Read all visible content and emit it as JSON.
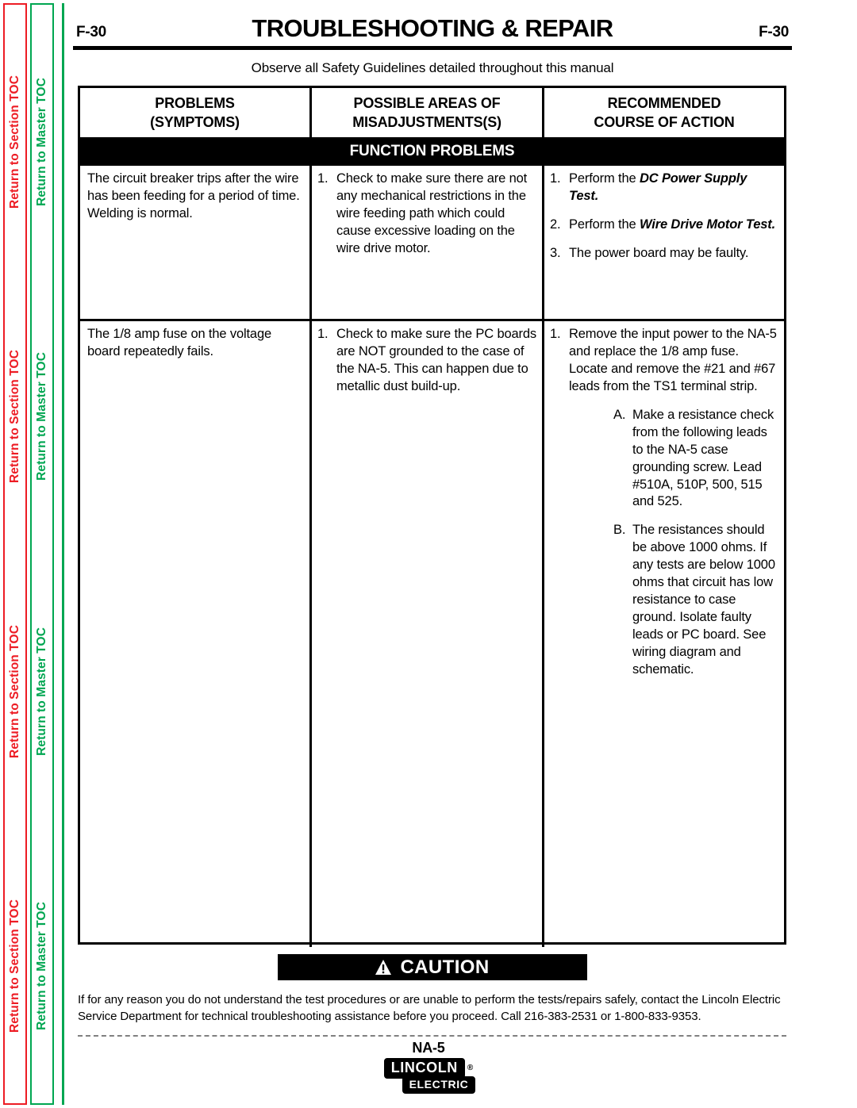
{
  "nav": {
    "section_toc_label": "Return to Section TOC",
    "master_toc_label": "Return to Master TOC",
    "section_color": "#ED1C24",
    "master_color": "#00A651",
    "repeat_count": 4
  },
  "header": {
    "folio_left": "F-30",
    "title": "TROUBLESHOOTING & REPAIR",
    "folio_right": "F-30",
    "safety_note": "Observe all Safety Guidelines detailed throughout this manual"
  },
  "table": {
    "headers": [
      {
        "line1": "PROBLEMS",
        "line2": "(SYMPTOMS)"
      },
      {
        "line1": "POSSIBLE AREAS OF",
        "line2": "MISADJUSTMENTS(S)"
      },
      {
        "line1": "RECOMMENDED",
        "line2": "COURSE OF ACTION"
      }
    ],
    "section_band": "FUNCTION PROBLEMS",
    "rows": [
      {
        "symptom": "The circuit breaker trips after the wire has been feeding for a period of time.  Welding is normal.",
        "areas": [
          {
            "marker": "1.",
            "text": "Check to make sure there are not any mechanical restrictions in the wire feeding path which could cause excessive loading on the wire drive motor."
          }
        ],
        "actions": [
          {
            "marker": "1.",
            "lead": "Perform the ",
            "emphasis": "DC Power Supply Test.",
            "tail": ""
          },
          {
            "marker": "2.",
            "lead": "Perform the ",
            "emphasis": "Wire Drive Motor Test.",
            "tail": ""
          },
          {
            "marker": "3.",
            "lead": "The power board may be faulty.",
            "emphasis": "",
            "tail": ""
          }
        ]
      },
      {
        "symptom": "The 1/8 amp fuse on the voltage board repeatedly fails.",
        "areas": [
          {
            "marker": "1.",
            "text": "Check to make sure the PC boards are NOT grounded to the case of the NA-5.  This can happen due to metallic dust build-up."
          }
        ],
        "actions": [
          {
            "marker": "1.",
            "lead": "Remove the input power to the NA-5 and replace the 1/8 amp fuse.  Locate and remove the #21 and #67 leads from the TS1 terminal strip.",
            "emphasis": "",
            "tail": "",
            "subitems": [
              {
                "marker": "A.",
                "text": "Make a resistance check from the following leads to the NA-5 case grounding screw.  Lead #510A, 510P, 500, 515 and 525."
              },
              {
                "marker": "B.",
                "text": "The resistances should be above 1000 ohms.  If any tests are below 1000 ohms that circuit has low resistance to case ground.  Isolate faulty leads or PC board.  See wiring diagram and schematic."
              }
            ]
          }
        ]
      }
    ]
  },
  "caution": {
    "icon": "warning-triangle-icon",
    "label": "CAUTION",
    "body": "If for any reason you do not understand the test procedures or are unable to perform the tests/repairs safely, contact the Lincoln Electric Service Department for technical troubleshooting assistance before you proceed. Call 216-383-2531 or 1-800-833-9353."
  },
  "footer": {
    "model": "NA-5",
    "logo_primary": "LINCOLN",
    "logo_registered": "®",
    "logo_secondary": "ELECTRIC"
  }
}
